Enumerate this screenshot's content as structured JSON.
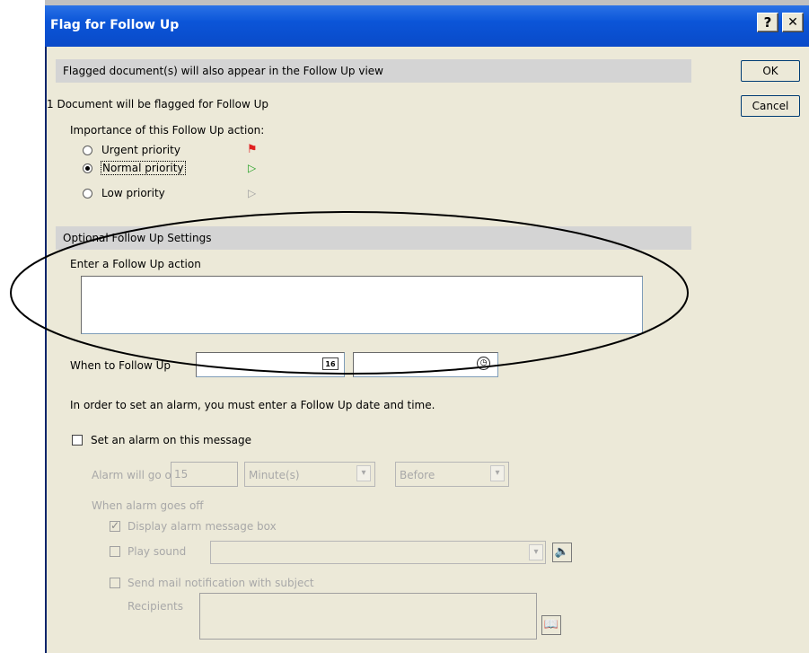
{
  "window": {
    "title": "Flag for Follow Up",
    "help_label": "?",
    "close_label": "✕"
  },
  "buttons": {
    "ok_label": "OK",
    "cancel_label": "Cancel"
  },
  "info_bar": "Flagged document(s) will also appear in the Follow Up view",
  "doc_count_text": "1 Document will be flagged for Follow Up",
  "importance": {
    "heading": "Importance of this Follow Up action:",
    "options": [
      {
        "label": "Urgent priority",
        "selected": false,
        "flag_color": "#e02020"
      },
      {
        "label": "Normal priority",
        "selected": true,
        "flag_color": "#22a022"
      },
      {
        "label": "Low priority",
        "selected": false,
        "flag_color": "#a0a0a0"
      }
    ]
  },
  "optional_bar": "Optional Follow Up Settings",
  "action": {
    "label": "Enter a Follow Up action",
    "value": ""
  },
  "when": {
    "label": "When to Follow Up",
    "date_value": "",
    "date_icon": "16",
    "time_value": ""
  },
  "alarm_note": "In order to set an alarm, you must enter a Follow Up date and time.",
  "alarm": {
    "checkbox_label": "Set an alarm on this message",
    "checked": false,
    "go_off_label": "Alarm will go off",
    "go_off_value": "15",
    "unit_value": "Minute(s)",
    "relative_value": "Before",
    "when_goes_off_label": "When alarm goes off",
    "display_box_label": "Display alarm message box",
    "play_sound_label": "Play sound",
    "sound_value": "",
    "send_mail_label": "Send mail notification with subject",
    "recipients_label": "Recipients",
    "recipients_value": ""
  },
  "annotation": {
    "shape": "ellipse",
    "color": "#000000"
  }
}
